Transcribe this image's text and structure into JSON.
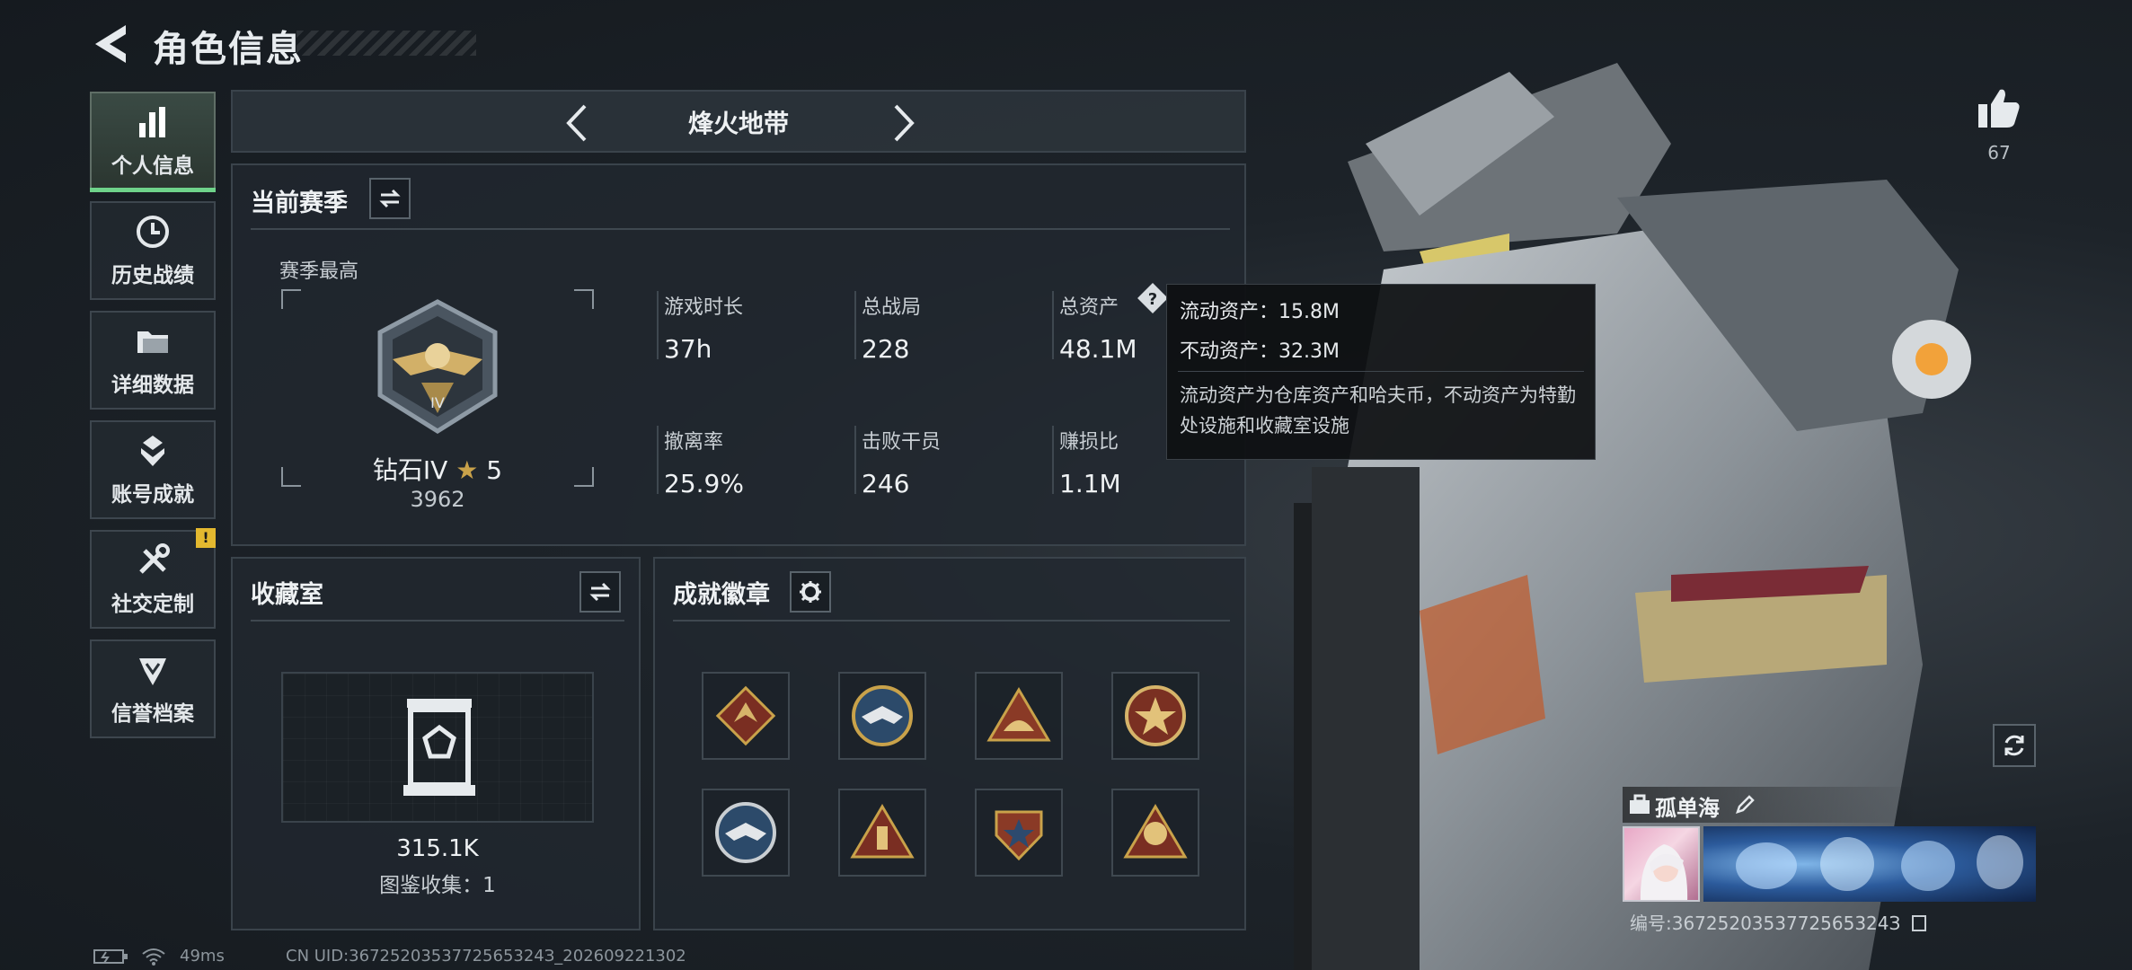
{
  "header": {
    "title": "角色信息"
  },
  "nav": {
    "items": [
      {
        "label": "个人信息",
        "active": true,
        "icon": "bar-chart-icon"
      },
      {
        "label": "历史战绩",
        "icon": "history-clock-icon"
      },
      {
        "label": "详细数据",
        "icon": "folder-icon"
      },
      {
        "label": "账号成就",
        "icon": "achievement-icon"
      },
      {
        "label": "社交定制",
        "icon": "tools-icon",
        "badge": "!"
      },
      {
        "label": "信誉档案",
        "icon": "shield-icon"
      }
    ]
  },
  "mode": {
    "title": "烽火地带"
  },
  "season": {
    "title": "当前赛季",
    "best_label": "赛季最高",
    "rank_name": "钻石IV",
    "rank_stars": "5",
    "rank_score": "3962",
    "stats": [
      {
        "label": "游戏时长",
        "value": "37h"
      },
      {
        "label": "总战局",
        "value": "228"
      },
      {
        "label": "总资产",
        "value": "48.1M"
      },
      {
        "label": "撤离率",
        "value": "25.9%"
      },
      {
        "label": "击败干员",
        "value": "246"
      },
      {
        "label": "赚损比",
        "value": "1.1M"
      }
    ]
  },
  "tooltip": {
    "liquid": "流动资产：15.8M",
    "fixed": "不动资产：32.3M",
    "desc": "流动资产为仓库资产和哈夫币，不动资产为特勤处设施和收藏室设施"
  },
  "collection": {
    "title": "收藏室",
    "value": "315.1K",
    "count": "图鉴收集：1"
  },
  "badges": {
    "title": "成就徽章"
  },
  "like": {
    "count": "67"
  },
  "player": {
    "name": "孤单海",
    "uid": "编号:3672520353772565324З"
  },
  "status": {
    "ping": "49ms",
    "uid": "CN UID:3672520353772565324З_202609221302"
  },
  "colors": {
    "accent": "#6fd38a",
    "badge": "#e3b82f",
    "gold": "#c9a24a"
  }
}
